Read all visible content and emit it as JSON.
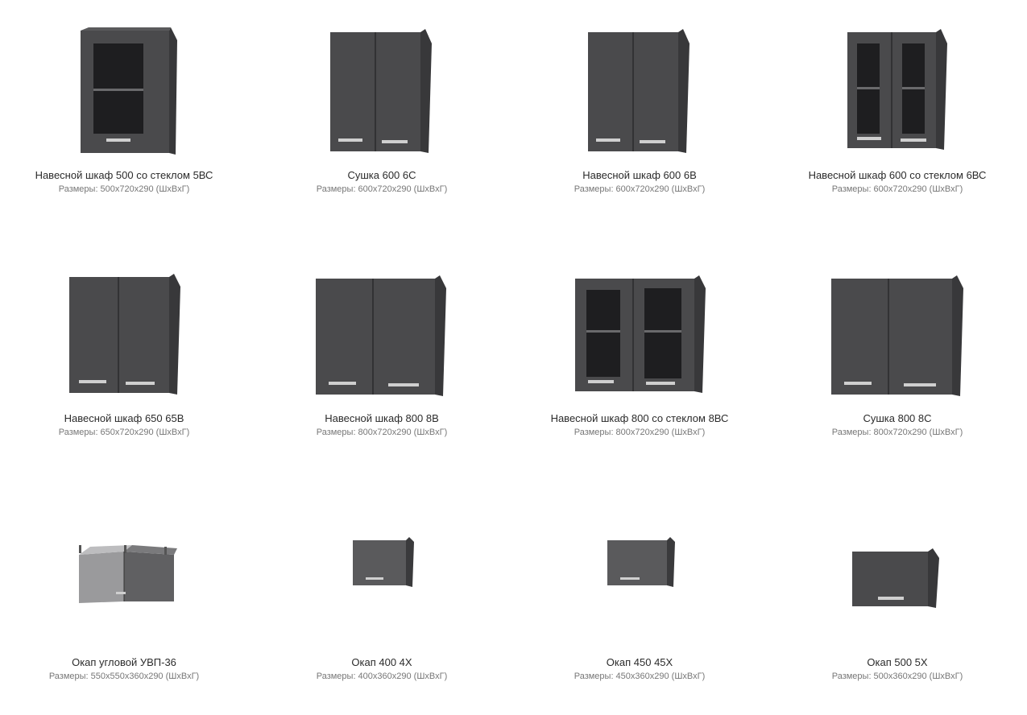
{
  "products": [
    {
      "title": "Навесной шкаф 500 со стеклом 5ВС",
      "dims": "Размеры: 500х720х290 (ШхВхГ)",
      "image": "cabinet-glass-1door"
    },
    {
      "title": "Сушка 600 6С",
      "dims": "Размеры: 600х720х290 (ШхВхГ)",
      "image": "cabinet-2door"
    },
    {
      "title": "Навесной шкаф 600 6В",
      "dims": "Размеры: 600х720х290 (ШхВхГ)",
      "image": "cabinet-2door"
    },
    {
      "title": "Навесной шкаф 600 со стеклом 6ВС",
      "dims": "Размеры: 600х720х290 (ШхВхГ)",
      "image": "cabinet-glass-2door"
    },
    {
      "title": "Навесной шкаф 650 65В",
      "dims": "Размеры: 650х720х290 (ШхВхГ)",
      "image": "cabinet-2door"
    },
    {
      "title": "Навесной шкаф 800 8В",
      "dims": "Размеры: 800х720х290 (ШхВхГ)",
      "image": "cabinet-2door-wide"
    },
    {
      "title": "Навесной шкаф 800 со стеклом 8ВС",
      "dims": "Размеры: 800х720х290 (ШхВхГ)",
      "image": "cabinet-glass-2door-wide"
    },
    {
      "title": "Сушка 800 8С",
      "dims": "Размеры: 800х720х290 (ШхВхГ)",
      "image": "cabinet-2door-wide"
    },
    {
      "title": "Окап угловой УВП-36",
      "dims": "Размеры: 550х550х360х290 (ШхВхГ)",
      "image": "corner-cabinet"
    },
    {
      "title": "Окап 400 4Х",
      "dims": "Размеры: 400х360х290 (ШхВхГ)",
      "image": "small-cabinet"
    },
    {
      "title": "Окап 450 45Х",
      "dims": "Размеры: 450х360х290 (ШхВхГ)",
      "image": "small-cabinet"
    },
    {
      "title": "Окап 500 5Х",
      "dims": "Размеры: 500х360х290 (ШхВхГ)",
      "image": "small-cabinet-large"
    }
  ],
  "colors": {
    "cabinet": "#4a4a4c",
    "cabinet_side": "#3a3a3c",
    "handle": "#cfcfcf",
    "glass": "#1e1e20"
  }
}
